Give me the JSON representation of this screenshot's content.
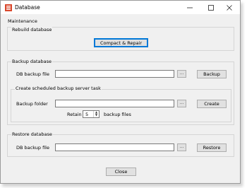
{
  "window": {
    "title": "Database"
  },
  "maintenance": {
    "label": "Maintenance",
    "rebuild": {
      "label": "Rebuild database",
      "compact_button": "Compact & Repair"
    }
  },
  "backup": {
    "label": "Backup database",
    "db_file_label": "DB backup file",
    "db_file_value": "",
    "browse_label": "...",
    "backup_button": "Backup",
    "scheduled": {
      "label": "Create scheduled backup server task",
      "folder_label": "Backup folder",
      "folder_value": "",
      "browse_label": "...",
      "create_button": "Create",
      "retain_label": "Retain",
      "retain_value": "5",
      "retain_suffix": "backup files"
    }
  },
  "restore": {
    "label": "Restore database",
    "db_file_label": "DB backup file",
    "db_file_value": "",
    "browse_label": "...",
    "restore_button": "Restore"
  },
  "footer": {
    "close_button": "Close"
  },
  "colors": {
    "accent": "#0078d7",
    "button_bg": "#e1e1e1",
    "window_bg": "#f0f0f0",
    "icon": "#d9472b"
  }
}
